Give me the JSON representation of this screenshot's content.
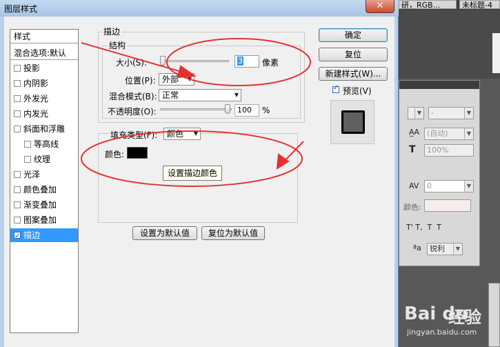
{
  "dialog": {
    "title": "图层样式",
    "close_symbol": "✕"
  },
  "style_list": {
    "header": "样式",
    "blend_options": "混合选项:默认",
    "items": [
      {
        "label": "投影",
        "checked": false
      },
      {
        "label": "内阴影",
        "checked": false
      },
      {
        "label": "外发光",
        "checked": false
      },
      {
        "label": "内发光",
        "checked": false
      },
      {
        "label": "斜面和浮雕",
        "checked": false
      },
      {
        "label": "等高线",
        "checked": false
      },
      {
        "label": "纹理",
        "checked": false
      },
      {
        "label": "光泽",
        "checked": false
      },
      {
        "label": "颜色叠加",
        "checked": false
      },
      {
        "label": "渐变叠加",
        "checked": false
      },
      {
        "label": "图案叠加",
        "checked": false
      },
      {
        "label": "描边",
        "checked": true
      }
    ]
  },
  "stroke": {
    "group_title": "描边",
    "structure_title": "结构",
    "size_label": "大小(S):",
    "size_value": "3",
    "size_unit": "像素",
    "position_label": "位置(P):",
    "position_value": "外部",
    "blend_label": "混合模式(B):",
    "blend_value": "正常",
    "opacity_label": "不透明度(O):",
    "opacity_value": "100",
    "opacity_unit": "%",
    "fill_type_label": "填充类型(F):",
    "fill_type_value": "颜色",
    "color_label": "颜色:",
    "color_hex": "#000000",
    "tooltip": "设置描边颜色",
    "make_default": "设置为默认值",
    "reset_default": "复位为默认值"
  },
  "buttons": {
    "ok": "确定",
    "reset": "复位",
    "new_style": "新建样式(W)...",
    "preview_label": "预览(V)",
    "preview_checked": true
  },
  "background": {
    "tab1": "研，RGB...",
    "tab2": "未标题-4",
    "panel_auto": "(自动)",
    "panel_percent": "100%",
    "panel_zero": "0",
    "panel_color_label": "颜色:",
    "panel_sharp": "锐利",
    "baidu_logo": "Bai du",
    "baidu_jy": "经验",
    "baidu_url": "jingyan.baidu.com"
  },
  "colors": {
    "annotation_red": "#e53030",
    "selection_blue": "#3399ff"
  }
}
